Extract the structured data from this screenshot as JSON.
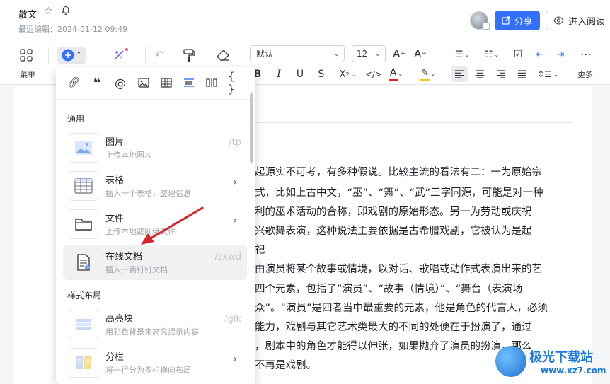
{
  "header": {
    "title": "散文",
    "last_edit": "最近编辑：2024-01-12 09:49",
    "share_label": "分享",
    "read_label": "进入阅读"
  },
  "toolbar": {
    "menu_label": "菜单",
    "font": "默认",
    "size": "12",
    "more_label": "更多"
  },
  "insert_panel": {
    "sections": [
      {
        "title": "通用",
        "items": [
          {
            "title": "图片",
            "desc": "上传本地图片",
            "shortcut": "/tp"
          },
          {
            "title": "表格",
            "desc": "插入一个表格，整理信息",
            "shortcut": ""
          },
          {
            "title": "文件",
            "desc": "上传本地或网盘文件",
            "shortcut": ""
          },
          {
            "title": "在线文档",
            "desc": "插入一篇钉钉文档",
            "shortcut": "/zxwd"
          }
        ]
      },
      {
        "title": "样式布局",
        "items": [
          {
            "title": "高亮块",
            "desc": "用彩色背景来高亮提示内容",
            "shortcut": "/glk"
          },
          {
            "title": "分栏",
            "desc": "将一行分为多栏横向布局",
            "shortcut": ""
          }
        ]
      }
    ]
  },
  "document": {
    "lines": [
      "起源实不可考，有多种假说。比较主流的看法有二：一为原始宗",
      "式，比如上古中文，“巫”、“舞”、“武”三字同源，可能是对一种",
      "利的巫术活动的合称，即戏剧的原始形态。另一为劳动或庆祝",
      "兴歌舞表演，这种说法主要依据是古希腊戏剧，它被认为是起",
      "祀",
      "由演员将某个故事或情境，以对话、歌唱或动作式表演出来的艺",
      "四个元素，包括了“演员”、“故事（情境）”、“舞台（表演场",
      "众”。“演员”是四者当中最重要的元素，他是角色的代言人，必须",
      "能力，戏剧与其它艺术类最大的不同的处便在于扮演了，通过",
      "，剧本中的角色才能得以伸张，如果抛弃了演员的扮演，那么",
      "不再是戏剧。"
    ]
  },
  "watermark": {
    "text": "极光下载站",
    "url": "www.xz7.com"
  },
  "colors": {
    "accent": "#3370ff",
    "arrow": "#d9262c"
  }
}
